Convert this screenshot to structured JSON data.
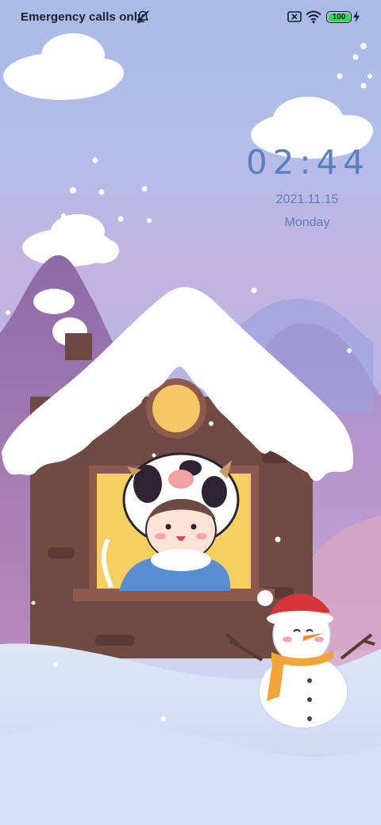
{
  "status_bar": {
    "carrier": "Emergency calls only",
    "icons": [
      "bell-off-icon",
      "sim-error-icon",
      "wifi-icon",
      "battery-icon",
      "charging-bolt-icon"
    ],
    "battery_level": "100",
    "battery_color": "#3ad45a"
  },
  "lock_screen": {
    "time": "02:44",
    "date": "2021.11.15",
    "weekday": "Monday",
    "text_color": "#5d7ebd"
  }
}
